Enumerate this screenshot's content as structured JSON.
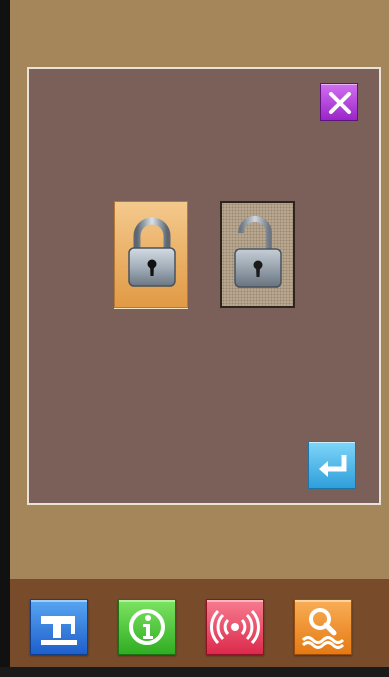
{
  "dialog": {
    "close_icon": "close-x-icon",
    "options": [
      {
        "id": "locked",
        "icon": "padlock-closed-icon",
        "selected": true
      },
      {
        "id": "unlocked",
        "icon": "padlock-open-icon",
        "selected": false
      }
    ],
    "confirm_icon": "enter-return-arrow-icon"
  },
  "toolbar": {
    "buttons": [
      {
        "id": "sewing",
        "icon": "sewing-machine-icon",
        "color": "#1e5fcb"
      },
      {
        "id": "info",
        "icon": "info-icon",
        "color": "#2fae22"
      },
      {
        "id": "signal",
        "icon": "wireless-signal-icon",
        "color": "#dc2a4b"
      },
      {
        "id": "search",
        "icon": "search-pattern-icon",
        "color": "#e67a14"
      }
    ]
  },
  "colors": {
    "background": "#a5855a",
    "dialog": "#7b605a",
    "selected_option": "#e19a45",
    "toolbar": "#784c2a"
  }
}
